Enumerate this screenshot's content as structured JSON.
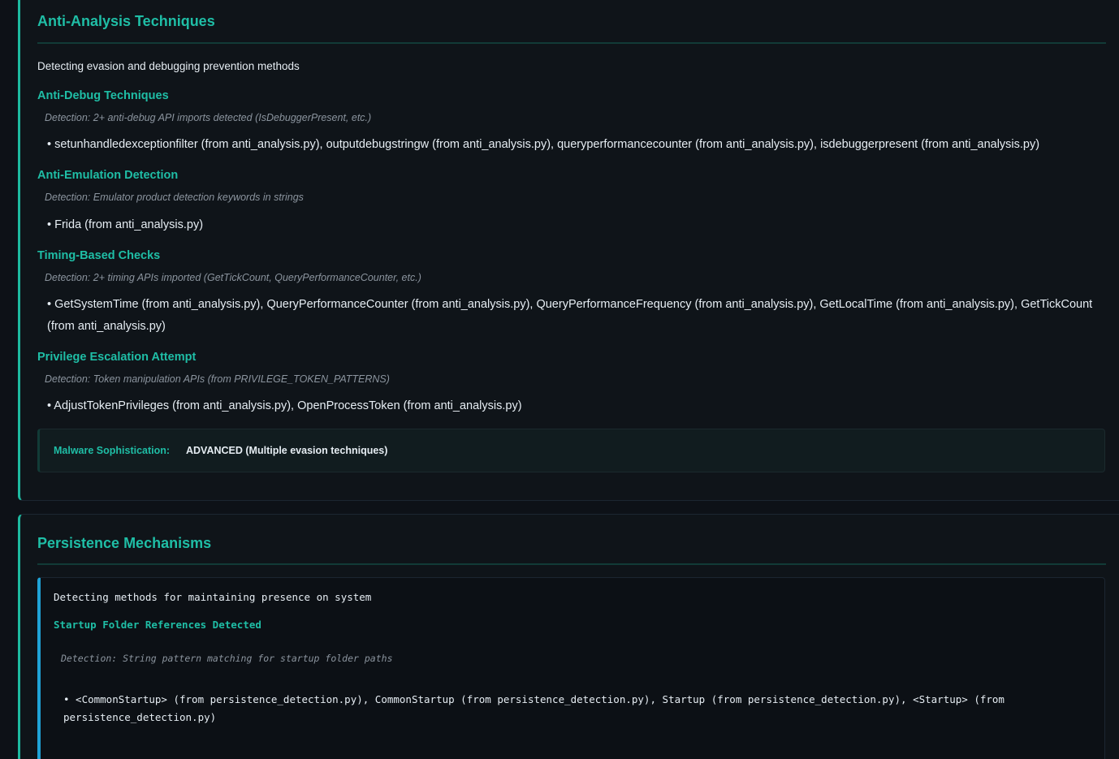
{
  "anti_analysis": {
    "title": "Anti-Analysis Techniques",
    "description": "Detecting evasion and debugging prevention methods",
    "subsections": [
      {
        "heading": "Anti-Debug Techniques",
        "detection": "Detection: 2+ anti-debug API imports detected (IsDebuggerPresent, etc.)",
        "items": "• setunhandledexceptionfilter (from anti_analysis.py), outputdebugstringw (from anti_analysis.py), queryperformancecounter (from anti_analysis.py), isdebuggerpresent (from anti_analysis.py)"
      },
      {
        "heading": "Anti-Emulation Detection",
        "detection": "Detection: Emulator product detection keywords in strings",
        "items": "• Frida (from anti_analysis.py)"
      },
      {
        "heading": "Timing-Based Checks",
        "detection": "Detection: 2+ timing APIs imported (GetTickCount, QueryPerformanceCounter, etc.)",
        "items": "• GetSystemTime (from anti_analysis.py), QueryPerformanceCounter (from anti_analysis.py), QueryPerformanceFrequency (from anti_analysis.py), GetLocalTime (from anti_analysis.py), GetTickCount (from anti_analysis.py)"
      },
      {
        "heading": "Privilege Escalation Attempt",
        "detection": "Detection: Token manipulation APIs (from PRIVILEGE_TOKEN_PATTERNS)",
        "items": "• AdjustTokenPrivileges (from anti_analysis.py), OpenProcessToken (from anti_analysis.py)"
      }
    ],
    "sophistication": {
      "label": "Malware Sophistication:",
      "value": "ADVANCED (Multiple evasion techniques)"
    }
  },
  "persistence": {
    "title": "Persistence Mechanisms",
    "description": "Detecting methods for maintaining presence on system",
    "subsection": {
      "heading": "Startup Folder References Detected",
      "detection": "Detection: String pattern matching for startup folder paths",
      "items": "• <CommonStartup> (from persistence_detection.py), CommonStartup (from persistence_detection.py), Startup (from persistence_detection.py), <Startup> (from persistence_detection.py)"
    }
  },
  "colors": {
    "accent": "#1fbea6",
    "background": "#0d1117",
    "code_border": "#1fa3d6"
  }
}
